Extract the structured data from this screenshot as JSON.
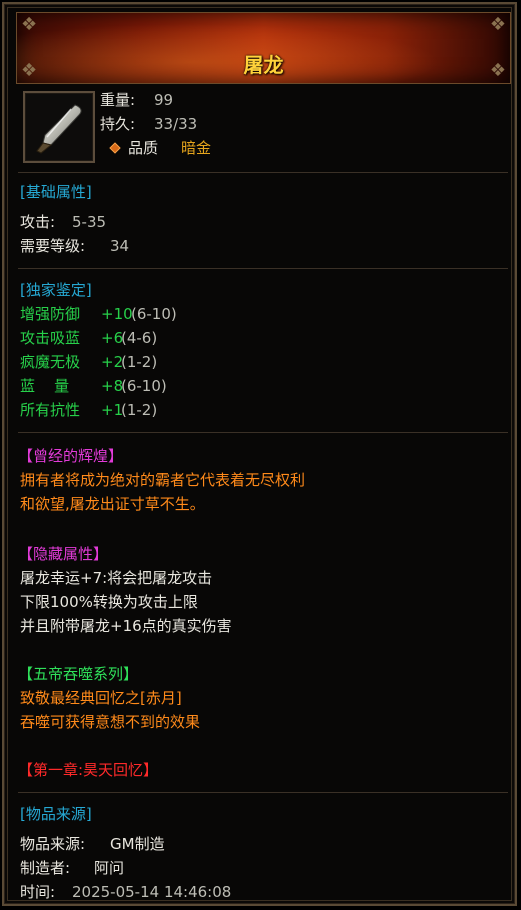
{
  "header": {
    "title": "屠龙"
  },
  "item": {
    "weight_label": "重量:",
    "weight_value": "99",
    "durability_label": "持久:",
    "durability_value": "33/33",
    "quality_label": "品质",
    "quality_value": "暗金",
    "icon": "sword-icon"
  },
  "basic": {
    "header": "[基础属性]",
    "attack_label": "攻击:",
    "attack_value": "5-35",
    "level_label": "需要等级:",
    "level_value": "34"
  },
  "exclusive": {
    "header": "[独家鉴定]",
    "rows": [
      {
        "name": "增强防御",
        "bonus": "+10",
        "range": "(6-10)"
      },
      {
        "name": "攻击吸蓝",
        "bonus": "+6",
        "range": "(4-6)"
      },
      {
        "name": "疯魔无极",
        "bonus": "+2",
        "range": "(1-2)"
      },
      {
        "name": "蓝    量",
        "bonus": "+8",
        "range": "(6-10)"
      },
      {
        "name": "所有抗性",
        "bonus": "+1",
        "range": "(1-2)"
      }
    ]
  },
  "glory": {
    "header": "【曾经的辉煌】",
    "line1": "拥有者将成为绝对的霸者它代表着无尽权利",
    "line2": "和欲望,屠龙出证寸草不生。"
  },
  "hidden": {
    "header": "【隐藏属性】",
    "line1": "屠龙幸运+7:将会把屠龙攻击",
    "line2": "下限100%转换为攻击上限",
    "line3": "并且附带屠龙+16点的真实伤害"
  },
  "series": {
    "header": "【五帝吞噬系列】",
    "line1": "致敬最经典回忆之[赤月]",
    "line2": "吞噬可获得意想不到的效果"
  },
  "chapter": {
    "header": "【第一章:昊天回忆】"
  },
  "source": {
    "header": "[物品来源]",
    "source_label": "物品来源:",
    "source_value": "GM制造",
    "maker_label": "制造者:",
    "maker_value": "阿问",
    "time_label": "时间:",
    "time_value": "2025-05-14 14:46:08"
  },
  "colors": {
    "title": "#ffd23a",
    "section_header": "#26a9d4",
    "attribute": "#27d04a",
    "lore_text": "#ff8a1a",
    "magenta_header": "#e23bd8",
    "green_header": "#2fe05a",
    "red_header": "#ff2a2a",
    "quality": "#e6a51c"
  }
}
